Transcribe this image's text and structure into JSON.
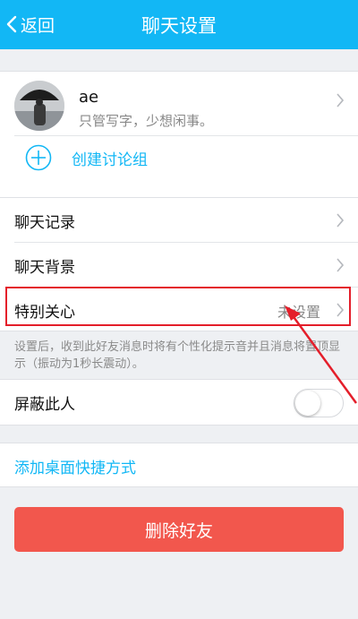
{
  "header": {
    "back_label": "返回",
    "title": "聊天设置",
    "background": "#12b7f5"
  },
  "profile": {
    "name": "ae",
    "signature": "只管写字，少想闲事。",
    "create_group_label": "创建讨论组"
  },
  "settings": {
    "chat_history_label": "聊天记录",
    "chat_background_label": "聊天背景",
    "special_care_label": "特别关心",
    "special_care_value": "未设置"
  },
  "special_care_note": "设置后，收到此好友消息时将有个性化提示音并且消息将置顶显示（振动为1秒长震动）。",
  "block": {
    "label": "屏蔽此人",
    "enabled": false
  },
  "shortcut_label": "添加桌面快捷方式",
  "delete_button_label": "删除好友",
  "colors": {
    "accent": "#12b7f5",
    "danger": "#f2574d",
    "annotation": "#e41e2a"
  }
}
